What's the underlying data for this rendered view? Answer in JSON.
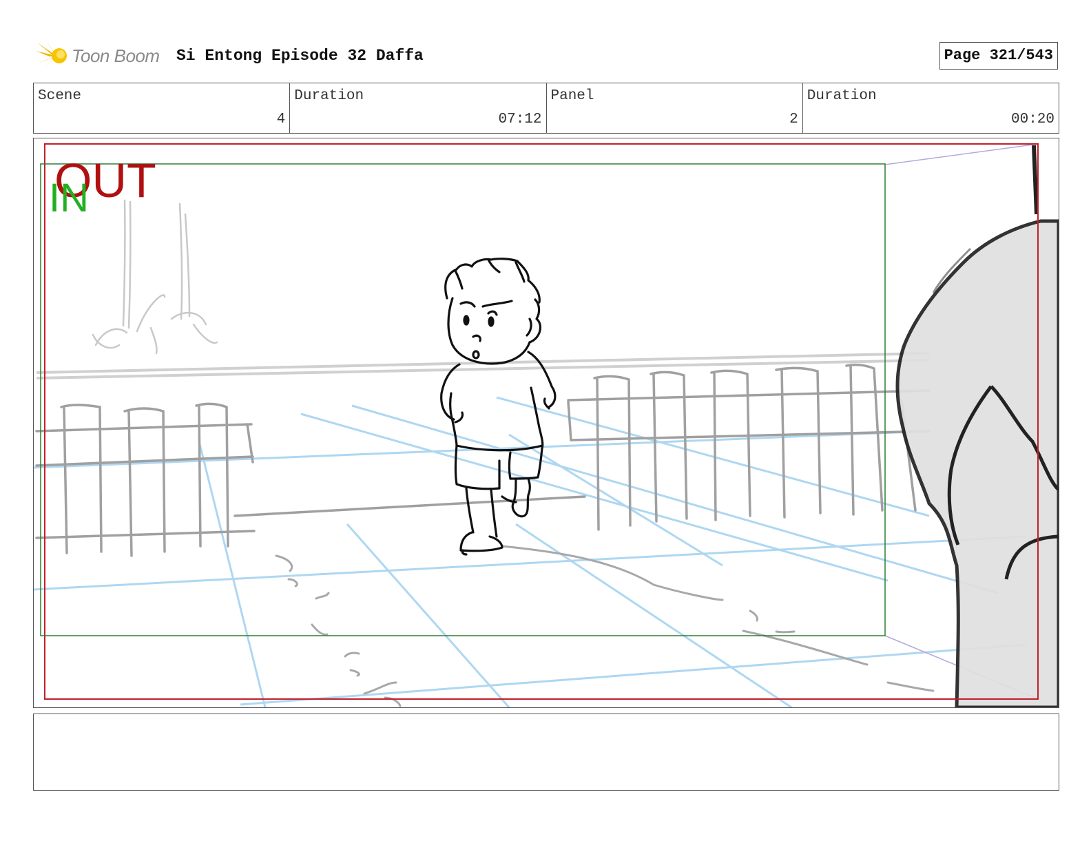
{
  "header": {
    "logo_text": "Toon Boom",
    "title": "Si Entong Episode 32 Daffa",
    "page": "Page 321/543"
  },
  "info": {
    "scene_label": "Scene",
    "scene_value": "4",
    "duration_label": "Duration",
    "duration_value": "07:12",
    "panel_label": "Panel",
    "panel_value": "2",
    "panel_duration_label": "Duration",
    "panel_duration_value": "00:20"
  },
  "panel": {
    "in_marker": "IN",
    "out_marker": "OUT",
    "colors": {
      "out_frame": "#c0202a",
      "in_frame": "#2e7d32",
      "in_text": "#22b022",
      "out_text": "#b01010",
      "guide_lines": "#9fd0ef",
      "fence": "#a0a0a0",
      "sketch": "#111111"
    }
  },
  "notes": {
    "text": ""
  }
}
